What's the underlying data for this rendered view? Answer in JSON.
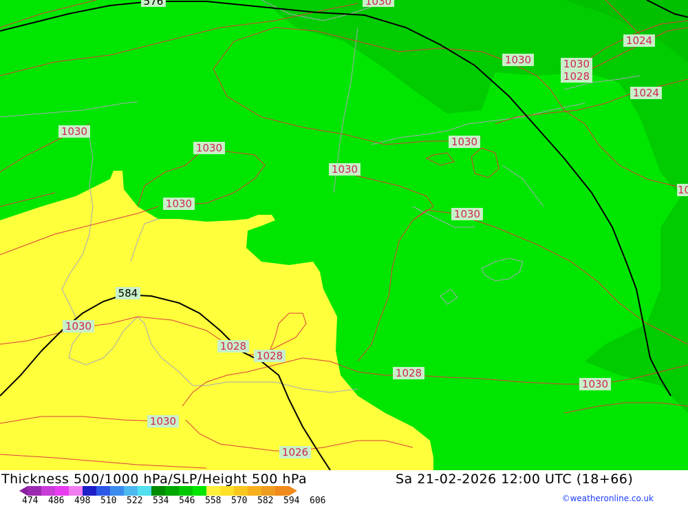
{
  "map": {
    "fill_colors": {
      "yellow": "#ffff3c",
      "green": "#00e600",
      "dark_green": "#00cc00"
    },
    "isobar_labels": [
      "1030",
      "1030",
      "1030",
      "1024",
      "1030",
      "1028",
      "1024",
      "1030",
      "1030",
      "1030",
      "1030",
      "1030",
      "1030",
      "1028",
      "1028",
      "1028",
      "1030",
      "1030",
      "1026",
      "1028",
      "10"
    ],
    "height_labels": [
      "576",
      "584"
    ]
  },
  "footer": {
    "title": "Thickness 500/1000 hPa/SLP/Height 500 hPa",
    "datetime": "Sa 21-02-2026 12:00 UTC (18+66)",
    "colorbar_ticks": [
      "474",
      "486",
      "498",
      "510",
      "522",
      "534",
      "546",
      "558",
      "570",
      "582",
      "594",
      "606"
    ],
    "colorbar_colors": [
      "#9a2ab0",
      "#c83cd8",
      "#e83cf0",
      "#f07cf0",
      "#1e1ec8",
      "#2c58e8",
      "#3c8cf0",
      "#4cb8f0",
      "#50e0f0",
      "#008c00",
      "#00a800",
      "#00c800",
      "#00e600",
      "#fff03c",
      "#ffe028",
      "#f8c81e",
      "#f8b01e",
      "#f09c1e",
      "#f08a1a"
    ],
    "credit": "©weatheronline.co.uk"
  }
}
